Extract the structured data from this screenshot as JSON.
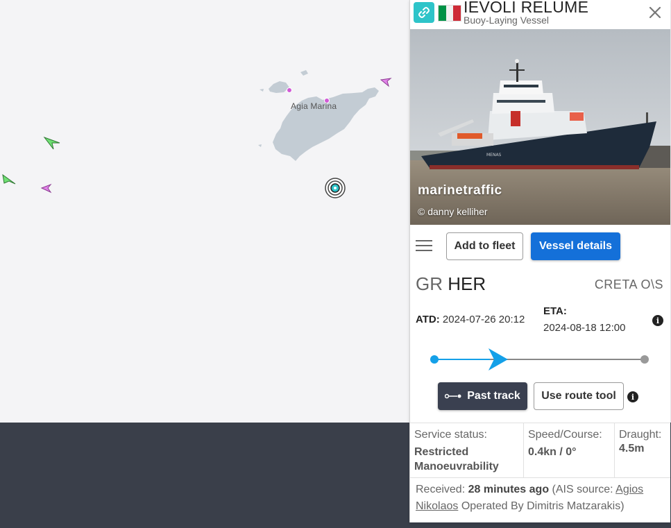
{
  "map": {
    "place_label": "Agia Marina",
    "colors": {
      "land": "#c3ccd4",
      "sea": "#f4f4f6",
      "port_marker": "#d25ad6",
      "green_vessel": "#6fde73",
      "pink_vessel": "#e183e8",
      "selected_ring": "#2ec4c9"
    }
  },
  "vessel": {
    "name": "IEVOLI RELUME",
    "type": "Buoy-Laying Vessel",
    "flag": "italy-flag",
    "photo_brand": "marinetraffic",
    "photo_credit": "© danny kelliher"
  },
  "actions": {
    "add_to_fleet": "Add to fleet",
    "vessel_details": "Vessel details"
  },
  "voyage": {
    "destination_country": "GR",
    "destination_port": "HER",
    "destination_name": "CRETA O\\S",
    "atd_label": "ATD:",
    "atd_value": "2024-07-26 20:12",
    "eta_label": "ETA:",
    "eta_value": "2024-08-18 12:00",
    "progress": 0.31
  },
  "track": {
    "past_track": "Past track",
    "route_tool": "Use route tool"
  },
  "status": {
    "service_label": "Service status:",
    "service_value": "Restricted Manoeuvrability",
    "speed_label": "Speed/Course:",
    "speed_value": "0.4kn / 0°",
    "draught_label": "Draught:",
    "draught_value": "4.5m"
  },
  "received": {
    "label": "Received:",
    "time": "28 minutes ago",
    "source_prefix": "(AIS source:",
    "source_link": "Agios Nikolaos",
    "operator": "Operated By Dimitris Matzarakis)"
  },
  "colors": {
    "accent_blue": "#1470d9",
    "teal": "#2ec4c9",
    "dark": "#3a4050",
    "progress_blue": "#14a0e8"
  }
}
